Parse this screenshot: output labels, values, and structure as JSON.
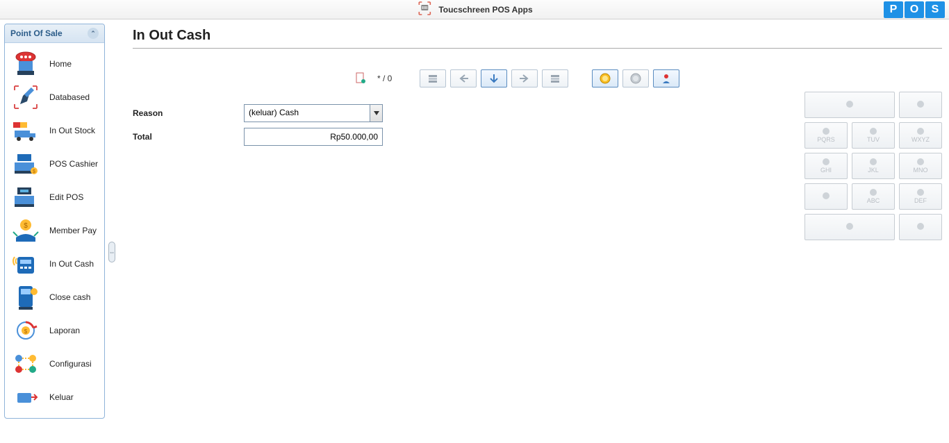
{
  "header": {
    "title": "Toucschreen POS Apps",
    "badges": [
      "P",
      "O",
      "S"
    ]
  },
  "sidebar": {
    "group_label": "Point Of Sale",
    "items": [
      {
        "label": "Home"
      },
      {
        "label": "Databased"
      },
      {
        "label": "In Out Stock"
      },
      {
        "label": "POS Cashier"
      },
      {
        "label": "Edit POS"
      },
      {
        "label": "Member Pay"
      },
      {
        "label": "In Out Cash"
      },
      {
        "label": "Close cash"
      },
      {
        "label": "Laporan"
      },
      {
        "label": "Configurasi"
      },
      {
        "label": "Keluar"
      }
    ]
  },
  "page": {
    "title": "In Out Cash",
    "pager": "* / 0",
    "form": {
      "reason_label": "Reason",
      "reason_value": "(keluar) Cash",
      "total_label": "Total",
      "total_value": "Rp50.000,00"
    },
    "keypad": {
      "k1": "",
      "k2": "",
      "k3": "PQRS",
      "k4": "TUV",
      "k5": "WXYZ",
      "k6": "GHI",
      "k7": "JKL",
      "k8": "MNO",
      "k9": "",
      "k10": "ABC",
      "k11": "DEF",
      "k12": "",
      "k13": ""
    }
  }
}
